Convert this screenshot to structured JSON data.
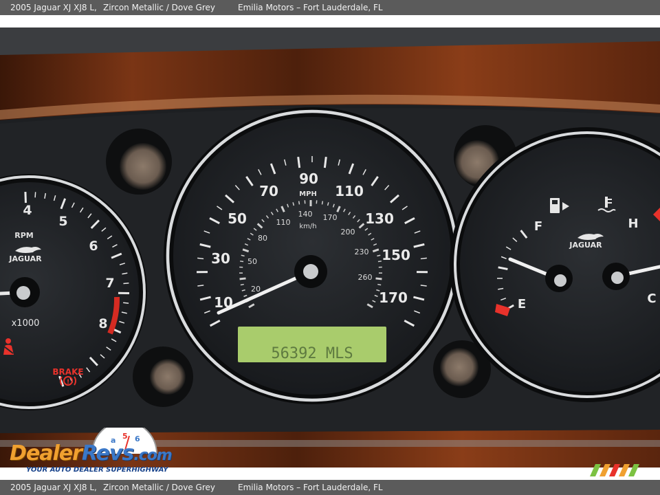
{
  "header": {
    "vehicle": "2005 Jaguar XJ XJ8 L,",
    "color": "Zircon Metallic / Dove Grey",
    "dealer": "Emilia Motors – Fort Lauderdale, FL"
  },
  "footer": {
    "vehicle": "2005 Jaguar XJ XJ8 L,",
    "color": "Zircon Metallic / Dove Grey",
    "dealer": "Emilia Motors – Fort Lauderdale, FL"
  },
  "tachometer": {
    "ticks": [
      "4",
      "5",
      "6",
      "7",
      "8"
    ],
    "unit": "RPM",
    "brand": "JAGUAR",
    "multiplier": "x1000",
    "brake_label": "BRAKE"
  },
  "speedometer": {
    "mph_ticks": [
      "10",
      "30",
      "50",
      "70",
      "90",
      "110",
      "130",
      "150",
      "170"
    ],
    "mph_unit": "MPH",
    "kmh_ticks": [
      "20",
      "50",
      "80",
      "110",
      "140",
      "170",
      "200",
      "230",
      "260"
    ],
    "kmh_unit": "km/h",
    "odometer": "56392 MLS"
  },
  "fuel_temp": {
    "fuel_full": "F",
    "fuel_empty": "E",
    "temp_hot": "H",
    "temp_cold": "C",
    "brand": "JAGUAR"
  },
  "watermark": {
    "logo_dealer": "Dealer",
    "logo_revs": "Revs",
    "logo_com": ".com",
    "tagline": "YOUR AUTO DEALER SUPERHIGHWAY"
  },
  "colors": {
    "bar_bg": "#5b5b5b",
    "gauge_face": "#232528",
    "chrome": "#d9dbdd",
    "lcd": "#a9cc6c",
    "warning_red": "#e8322b",
    "wood": "#6b2e12"
  }
}
